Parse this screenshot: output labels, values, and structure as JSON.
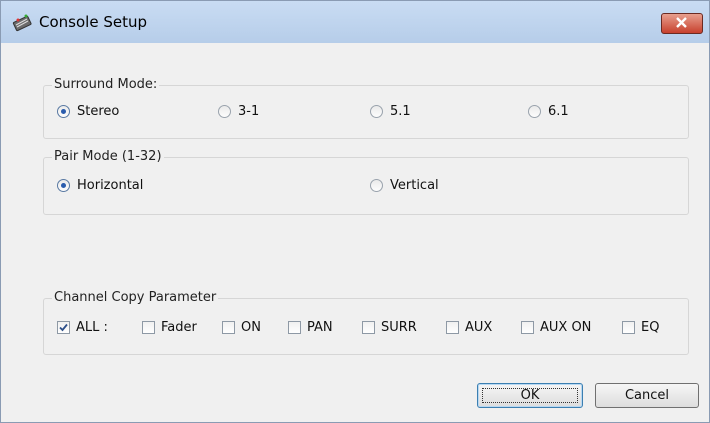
{
  "window": {
    "title": "Console Setup"
  },
  "surround": {
    "label": "Surround Mode:",
    "options": [
      "Stereo",
      "3-1",
      "5.1",
      "6.1"
    ],
    "selected": "Stereo"
  },
  "pair": {
    "label": "Pair Mode (1-32)",
    "options": [
      "Horizontal",
      "Vertical"
    ],
    "selected": "Horizontal"
  },
  "copy": {
    "label": "Channel Copy Parameter",
    "items": [
      {
        "label": "ALL :",
        "checked": true
      },
      {
        "label": "Fader",
        "checked": false
      },
      {
        "label": "ON",
        "checked": false
      },
      {
        "label": "PAN",
        "checked": false
      },
      {
        "label": "SURR",
        "checked": false
      },
      {
        "label": "AUX",
        "checked": false
      },
      {
        "label": "AUX ON",
        "checked": false
      },
      {
        "label": "EQ",
        "checked": false
      }
    ]
  },
  "buttons": {
    "ok": "OK",
    "cancel": "Cancel"
  }
}
